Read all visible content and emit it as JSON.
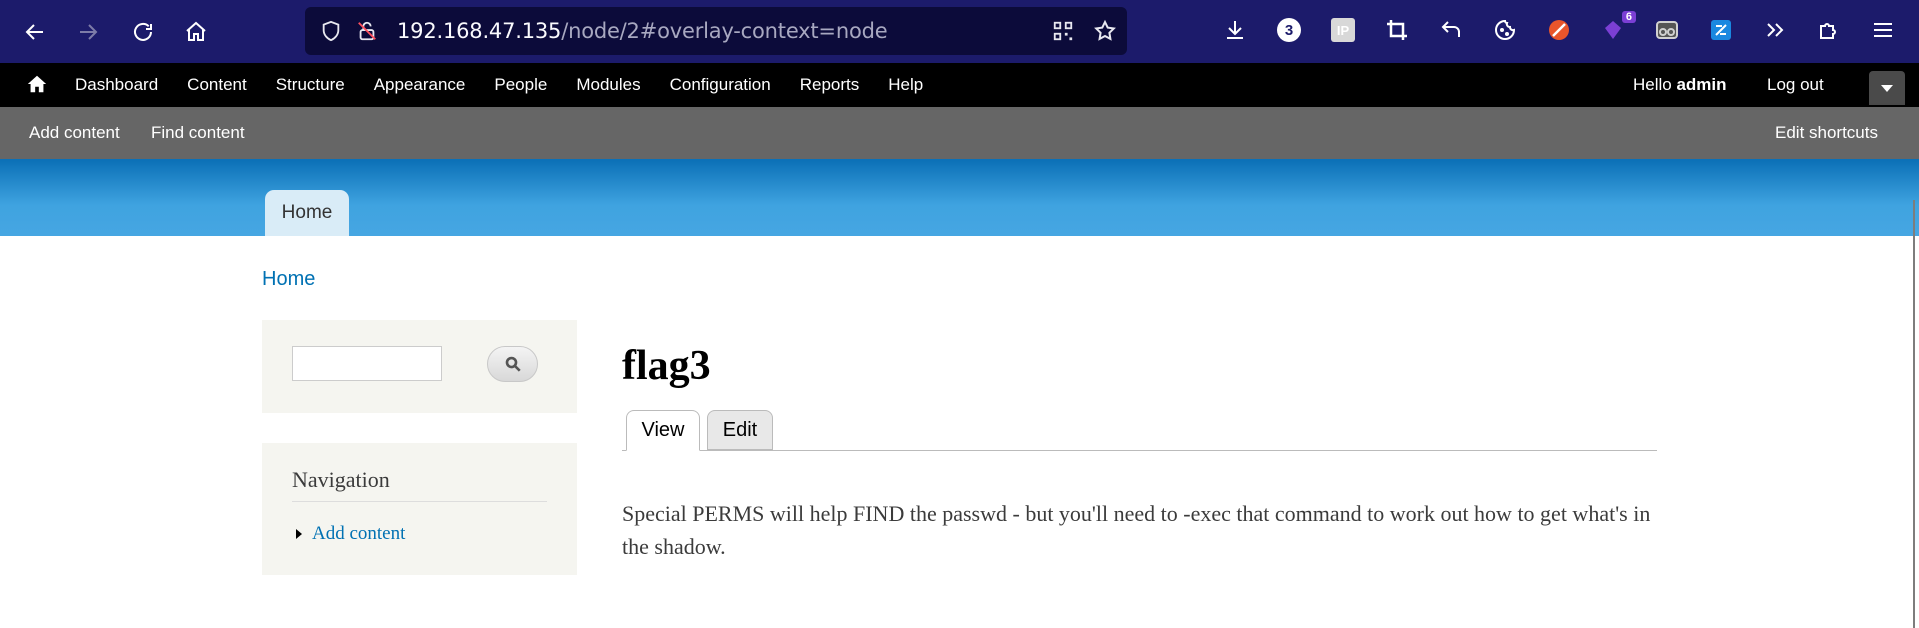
{
  "browser": {
    "url_host": "192.168.47.135",
    "url_path": "/node/2#overlay-context=node",
    "tab_count_badge": "3",
    "extension_badge": "6",
    "ip_label": "IP"
  },
  "admin_toolbar": {
    "menu": [
      "Dashboard",
      "Content",
      "Structure",
      "Appearance",
      "People",
      "Modules",
      "Configuration",
      "Reports",
      "Help"
    ],
    "hello_prefix": "Hello ",
    "username": "admin",
    "logout": "Log out"
  },
  "shortcuts": {
    "add_content": "Add content",
    "find_content": "Find content",
    "edit_shortcuts": "Edit shortcuts"
  },
  "header": {
    "primary_tab": "Home"
  },
  "breadcrumb": "Home",
  "sidebar": {
    "search_value": "",
    "navigation_title": "Navigation",
    "navigation_items": [
      "Add content"
    ]
  },
  "node": {
    "title": "flag3",
    "tabs": [
      "View",
      "Edit"
    ],
    "body": "Special PERMS will help FIND the passwd - but you'll need to -exec that command to work out how to get what's in the shadow."
  }
}
